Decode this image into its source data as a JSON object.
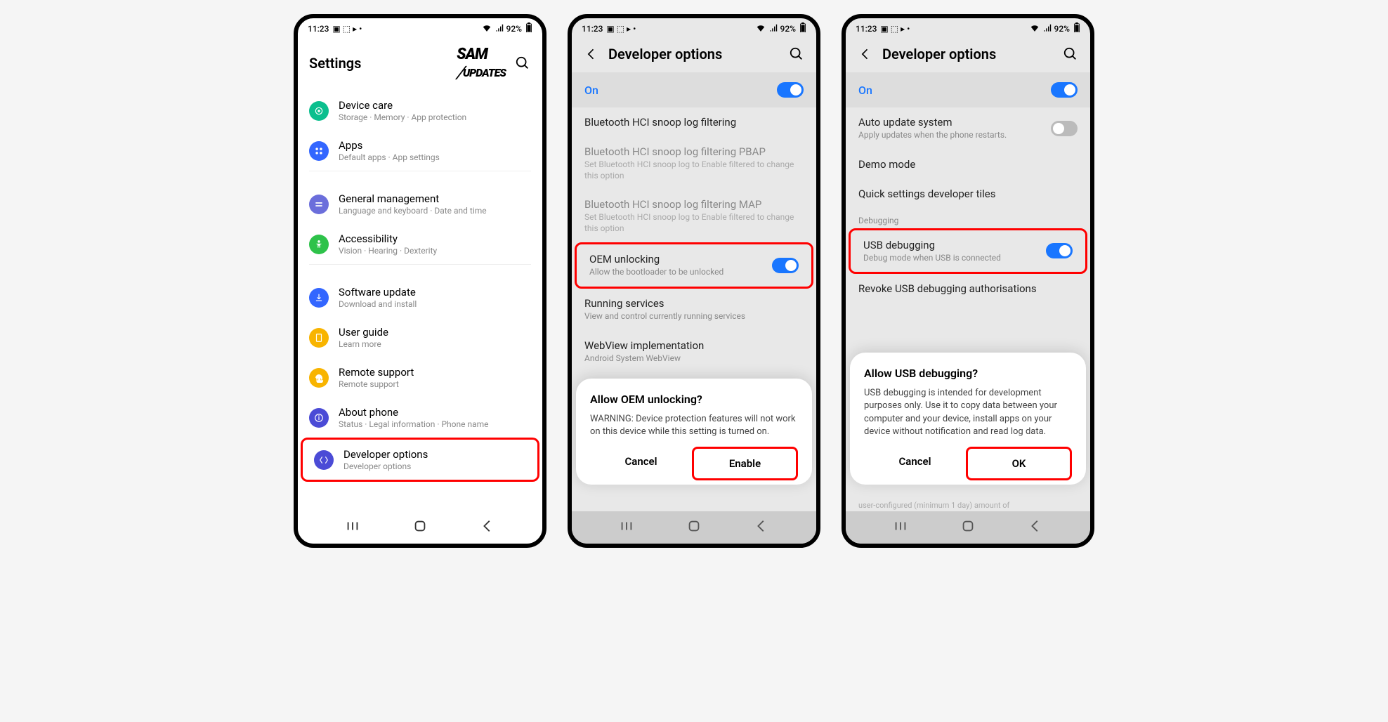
{
  "status": {
    "time": "11:23",
    "battery": "92%"
  },
  "screen1": {
    "title": "Settings",
    "logo": "SAM UPDATES",
    "items": [
      {
        "title": "Device care",
        "sub": "Storage · Memory · App protection",
        "color": "#0bbf8e"
      },
      {
        "title": "Apps",
        "sub": "Default apps · App settings",
        "color": "#3366ff"
      },
      {
        "title": "General management",
        "sub": "Language and keyboard · Date and time",
        "color": "#6b6edb"
      },
      {
        "title": "Accessibility",
        "sub": "Vision · Hearing · Dexterity",
        "color": "#2ec24a"
      },
      {
        "title": "Software update",
        "sub": "Download and install",
        "color": "#3366ff"
      },
      {
        "title": "User guide",
        "sub": "Learn more",
        "color": "#f8b400"
      },
      {
        "title": "Remote support",
        "sub": "Remote support",
        "color": "#f8b400"
      },
      {
        "title": "About phone",
        "sub": "Status · Legal information · Phone name",
        "color": "#4b4bd6"
      },
      {
        "title": "Developer options",
        "sub": "Developer options",
        "color": "#4b4bd6"
      }
    ]
  },
  "screen2": {
    "title": "Developer options",
    "toggle": "On",
    "items": [
      {
        "title": "Bluetooth HCI snoop log filtering",
        "sub": "",
        "grey": false
      },
      {
        "title": "Bluetooth HCI snoop log filtering PBAP",
        "sub": "Set Bluetooth HCI snoop log to Enable filtered to change this option",
        "grey": true
      },
      {
        "title": "Bluetooth HCI snoop log filtering MAP",
        "sub": "Set Bluetooth HCI snoop log to Enable filtered to change this option",
        "grey": true
      },
      {
        "title": "OEM unlocking",
        "sub": "Allow the bootloader to be unlocked",
        "toggle": true,
        "highlight": true
      },
      {
        "title": "Running services",
        "sub": "View and control currently running services"
      },
      {
        "title": "WebView implementation",
        "sub": "Android System WebView"
      }
    ],
    "dialog": {
      "title": "Allow OEM unlocking?",
      "body": "WARNING: Device protection features will not work on this device while this setting is turned on.",
      "cancel": "Cancel",
      "confirm": "Enable"
    }
  },
  "screen3": {
    "title": "Developer options",
    "toggle": "On",
    "items": [
      {
        "title": "Auto update system",
        "sub": "Apply updates when the phone restarts.",
        "toggle": true,
        "toggleOff": true
      },
      {
        "title": "Demo mode",
        "sub": ""
      },
      {
        "title": "Quick settings developer tiles",
        "sub": ""
      }
    ],
    "section": "Debugging",
    "debugItems": [
      {
        "title": "USB debugging",
        "sub": "Debug mode when USB is connected",
        "toggle": true,
        "highlight": true
      },
      {
        "title": "Revoke USB debugging authorisations",
        "sub": ""
      }
    ],
    "truncated": "user-configured (minimum 1 day) amount of",
    "dialog": {
      "title": "Allow USB debugging?",
      "body": "USB debugging is intended for development purposes only. Use it to copy data between your computer and your device, install apps on your device without notification and read log data.",
      "cancel": "Cancel",
      "confirm": "OK"
    }
  }
}
